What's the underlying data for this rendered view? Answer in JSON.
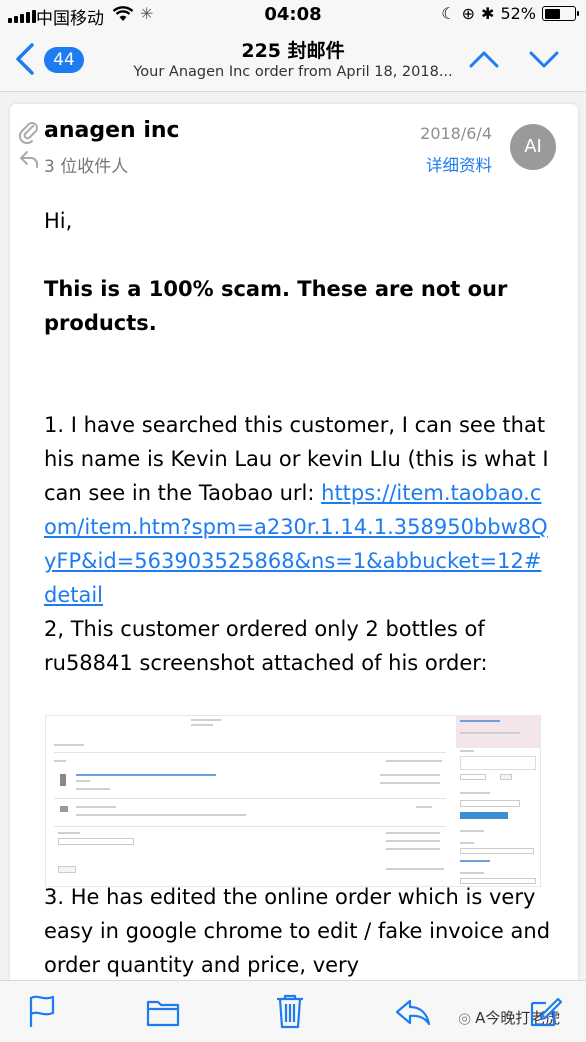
{
  "status_bar": {
    "carrier": "中国移动",
    "time": "04:08",
    "battery_percent": "52%",
    "battery_level": 0.52
  },
  "nav": {
    "badge_count": "44",
    "title": "225 封邮件",
    "subtitle": "Your Anagen Inc order from April 18, 2018..."
  },
  "message": {
    "sender": "anagen inc",
    "recipients": "3 位收件人",
    "date": "2018/6/4",
    "details_link": "详细资料",
    "avatar_initials": "AI",
    "greeting": "Hi,",
    "headline": "This is a 100% scam. These are not our products.",
    "point1_text": "1. I have searched this customer, I can see that his name is Kevin Lau or kevin LIu (this is what I can see in the Taobao url: ",
    "point1_link": "https://item.taobao.com/item.htm?spm=a230r.1.14.1.358950bbw8QyFP&id=563903525868&ns=1&abbucket=12#detail",
    "point2": "2, This customer ordered only 2 bottles of ru58841 screenshot attached of his order:",
    "point3": "3. He has edited the online order which is very easy in google chrome to edit / fake invoice and order quantity and price, very"
  },
  "toolbar": {
    "watermark": "A今晚打老虎"
  },
  "colors": {
    "accent": "#1d7cf2",
    "avatar_bg": "#9a9a9a"
  },
  "icons": [
    "wifi-icon",
    "back-chevron-icon",
    "chevron-up-icon",
    "chevron-down-icon",
    "paperclip-icon",
    "reply-icon",
    "flag-icon",
    "folder-icon",
    "trash-icon",
    "compose-icon"
  ]
}
